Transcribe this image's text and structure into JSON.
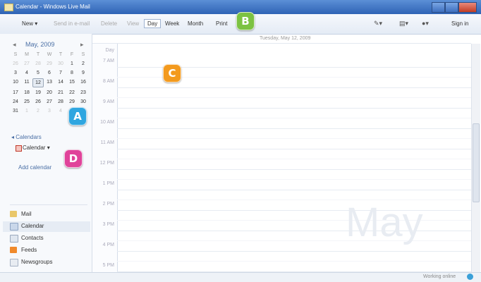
{
  "window": {
    "title": "Calendar - Windows Live Mail"
  },
  "toolbar": {
    "new": "New ▾",
    "send_email": "Send in e-mail",
    "delete": "Delete",
    "view": "View",
    "day": "Day",
    "week": "Week",
    "month": "Month",
    "print": "Print",
    "sign_in": "Sign in"
  },
  "minical": {
    "month_label": "May, 2009",
    "day_names": [
      "S",
      "M",
      "T",
      "W",
      "T",
      "F",
      "S"
    ],
    "weeks": [
      [
        "26",
        "27",
        "28",
        "29",
        "30",
        "1",
        "2"
      ],
      [
        "3",
        "4",
        "5",
        "6",
        "7",
        "8",
        "9"
      ],
      [
        "10",
        "11",
        "12",
        "13",
        "14",
        "15",
        "16"
      ],
      [
        "17",
        "18",
        "19",
        "20",
        "21",
        "22",
        "23"
      ],
      [
        "24",
        "25",
        "26",
        "27",
        "28",
        "29",
        "30"
      ],
      [
        "31",
        "1",
        "2",
        "3",
        "4",
        "5",
        "6"
      ]
    ],
    "today": "12"
  },
  "calendars": {
    "header": "◂ Calendars",
    "item": "Calendar ▾",
    "add": "Add calendar"
  },
  "nav": [
    "Mail",
    "Calendar",
    "Contacts",
    "Feeds",
    "Newsgroups"
  ],
  "dayview": {
    "header": "Tuesday, May 12, 2009",
    "day_label": "Day",
    "times": [
      "7 AM",
      "8 AM",
      "9 AM",
      "10 AM",
      "11 AM",
      "12 PM",
      "1 PM",
      "2 PM",
      "3 PM",
      "4 PM",
      "5 PM"
    ],
    "watermark": "May"
  },
  "status": {
    "text": "Working online"
  },
  "badges": {
    "a": "A",
    "b": "B",
    "c": "C",
    "d": "D"
  },
  "colors": {
    "badge_a": "#2fa6e0",
    "badge_b": "#7cc242",
    "badge_c": "#f39a1e",
    "badge_d": "#e0439a"
  }
}
